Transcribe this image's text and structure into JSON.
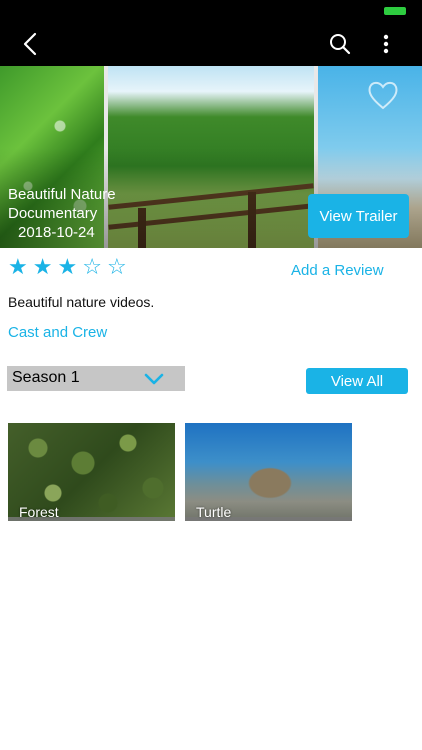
{
  "colors": {
    "accent": "#1ab3e6",
    "nav_bar": "#000000",
    "battery": "#2ecc40",
    "season_select_bg": "#c6c6c6"
  },
  "nav": {
    "icons": [
      "back-chevron-icon",
      "search-icon",
      "more-vertical-icon"
    ]
  },
  "hero": {
    "title_line1": "Beautiful Nature",
    "title_line2": "Documentary",
    "date": "2018-10-24",
    "trailer_button": "View Trailer",
    "favorite_icon": "heart-icon"
  },
  "rating": {
    "value": 3,
    "max": 5,
    "filled_star": "★",
    "empty_star": "☆"
  },
  "actions": {
    "add_review": "Add a Review",
    "description": "Beautiful nature videos.",
    "cast_crew": "Cast and Crew"
  },
  "season": {
    "selected": "Season 1",
    "view_all": "View All"
  },
  "episodes": [
    {
      "title": "Forest"
    },
    {
      "title": "Turtle"
    }
  ]
}
